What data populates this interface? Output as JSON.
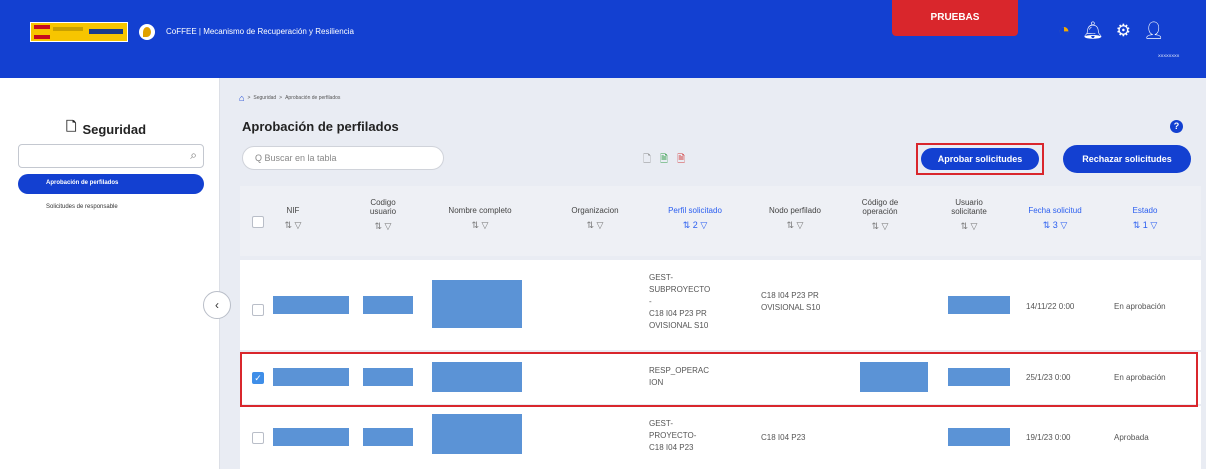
{
  "header": {
    "app_title": "CoFFEE  |  Mecanismo de Recuperación y Resiliencia",
    "environment": "PRUEBAS",
    "user_id": "XXXXXXXX",
    "colors": {
      "primary": "#1340d1",
      "env_badge": "#d9262c"
    }
  },
  "sidebar": {
    "title": "Seguridad",
    "search_placeholder": "",
    "items": [
      {
        "label": "Aprobación de perfilados",
        "active": true
      },
      {
        "label": "Solicitudes de responsable",
        "active": false
      }
    ],
    "collapse_glyph": "‹"
  },
  "breadcrumb": {
    "items": [
      "Seguridad",
      "Aprobación de perfilados"
    ],
    "separator": ">"
  },
  "page": {
    "title": "Aprobación de perfilados",
    "table_search_placeholder": "Q  Buscar en la tabla",
    "approve_button": "Aprobar solicitudes",
    "reject_button": "Rechazar solicitudes",
    "help_glyph": "?"
  },
  "table": {
    "headers": [
      {
        "label": "NIF",
        "sort": "⇅ ▽"
      },
      {
        "label": "Codigo usuario",
        "sort": "⇅ ▽"
      },
      {
        "label": "Nombre completo",
        "sort": "⇅ ▽"
      },
      {
        "label": "Organizacion",
        "sort": "⇅ ▽"
      },
      {
        "label": "Perfil solicitado",
        "sort": "⇅ 2 ▽",
        "active": true
      },
      {
        "label": "Nodo perfilado",
        "sort": "⇅ ▽"
      },
      {
        "label": "Código de operación",
        "sort": "⇅ ▽"
      },
      {
        "label": "Usuario solicitante",
        "sort": "⇅ ▽"
      },
      {
        "label": "Fecha solicitud",
        "sort": "⇅ 3 ▽",
        "active": true
      },
      {
        "label": "Estado",
        "sort": "⇅ 1 ▽",
        "active": true
      }
    ],
    "rows": [
      {
        "checked": false,
        "perfil": "GEST-\nSUBPROYECTO\n-\nC18 I04 P23 PR\nOVISIONAL S10",
        "nodo": "C18 I04 P23 PR\nOVISIONAL S10",
        "fecha": "14/11/22 0:00",
        "estado": "En aprobación"
      },
      {
        "checked": true,
        "perfil": "RESP_OPERAC\nION",
        "nodo": "",
        "fecha": "25/1/23 0:00",
        "estado": "En aprobación"
      },
      {
        "checked": false,
        "perfil": "GEST-\nPROYECTO-\nC18 I04 P23",
        "nodo": "C18 I04 P23",
        "fecha": "19/1/23 0:00",
        "estado": "Aprobada"
      }
    ]
  }
}
